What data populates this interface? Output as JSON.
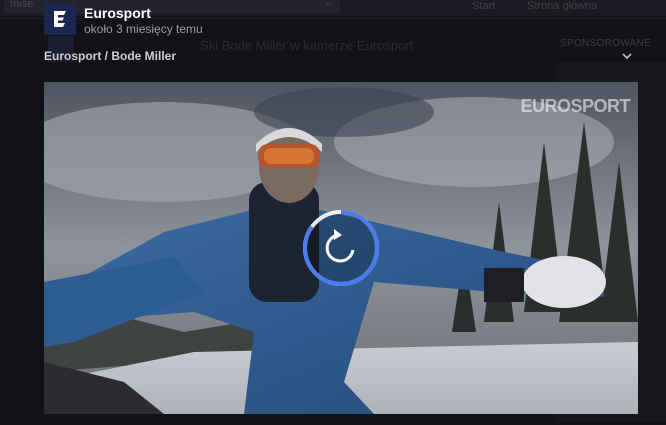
{
  "background": {
    "search_text": "mise",
    "top_buttons": [
      "Start",
      "Strona główna"
    ],
    "post_text": "Ski Bode Miller w kamerze Eurosport",
    "sidebar_title": "SPONSOROWANE"
  },
  "post": {
    "author": "Eurosport",
    "timestamp": "około 3 miesięcy temu",
    "breadcrumb": "Eurosport / Bode Miller"
  },
  "video": {
    "watermark": "EUROSPORT",
    "replay_progress": 0.85
  },
  "colors": {
    "logo_bg": "#1d2553",
    "replay_ring": "#4a7bf0",
    "page_bg": "#121216"
  },
  "icons": {
    "logo": "eurosport-e-icon",
    "dropdown": "chevron-down-icon",
    "replay": "replay-icon",
    "next": "chevron-right-icon"
  }
}
